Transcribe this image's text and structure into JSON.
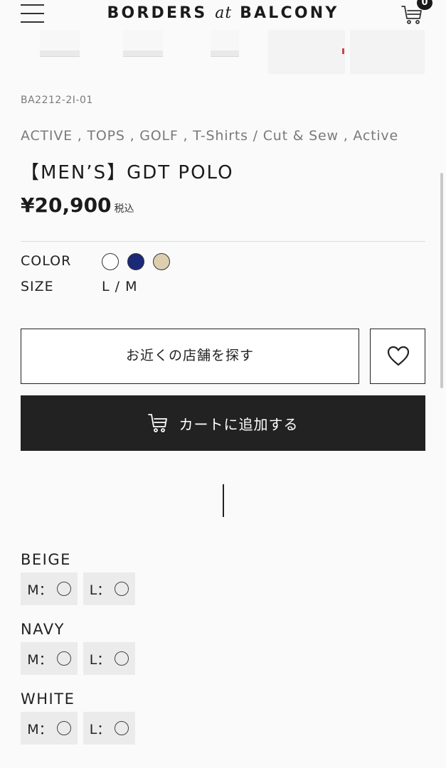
{
  "header": {
    "logo_left": "BORDERS ",
    "logo_at": "at",
    "logo_right": " BALCONY",
    "cart_count": "0"
  },
  "product": {
    "sku": "BA2212-2I-01",
    "categories": "ACTIVE , TOPS , GOLF , T-Shirts / Cut & Sew , Active",
    "title": "【MEN’S】GDT POLO",
    "price": "¥20,900",
    "tax_label": "税込"
  },
  "attributes": {
    "color_label": "COLOR",
    "colors": [
      {
        "name": "white",
        "hex": "#ffffff"
      },
      {
        "name": "navy",
        "hex": "#1a2a78"
      },
      {
        "name": "beige",
        "hex": "#dccfb0"
      }
    ],
    "size_label": "SIZE",
    "sizes": "L / M"
  },
  "actions": {
    "store_label": "お近くの店舗を探す",
    "cart_label": "カートに追加する"
  },
  "stock": [
    {
      "color": "BEIGE",
      "items": [
        {
          "label": "M：",
          "mark": "◯"
        },
        {
          "label": "L：",
          "mark": "◯"
        }
      ]
    },
    {
      "color": "NAVY",
      "items": [
        {
          "label": "M：",
          "mark": "◯"
        },
        {
          "label": "L：",
          "mark": "◯"
        }
      ]
    },
    {
      "color": "WHITE",
      "items": [
        {
          "label": "M：",
          "mark": "◯"
        },
        {
          "label": "L：",
          "mark": "◯"
        }
      ]
    }
  ],
  "icons": [
    "menu-icon",
    "cart-icon",
    "heart-icon",
    "cart-icon"
  ]
}
